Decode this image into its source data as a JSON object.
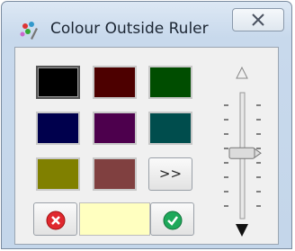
{
  "window": {
    "title": "Colour Outside Ruler"
  },
  "swatches": [
    {
      "color": "#000000",
      "selected": true
    },
    {
      "color": "#4d0000",
      "selected": false
    },
    {
      "color": "#004d00",
      "selected": false
    },
    {
      "color": "#00004d",
      "selected": false
    },
    {
      "color": "#4d004d",
      "selected": false
    },
    {
      "color": "#004d4d",
      "selected": false
    },
    {
      "color": "#808000",
      "selected": false
    },
    {
      "color": "#804040",
      "selected": false
    }
  ],
  "more_button": {
    "label": ">>"
  },
  "preview": {
    "color": "#ffffc0"
  },
  "buttons": {
    "cancel": "cancel-icon",
    "ok": "check-icon"
  },
  "slider": {
    "value": 0.48
  }
}
